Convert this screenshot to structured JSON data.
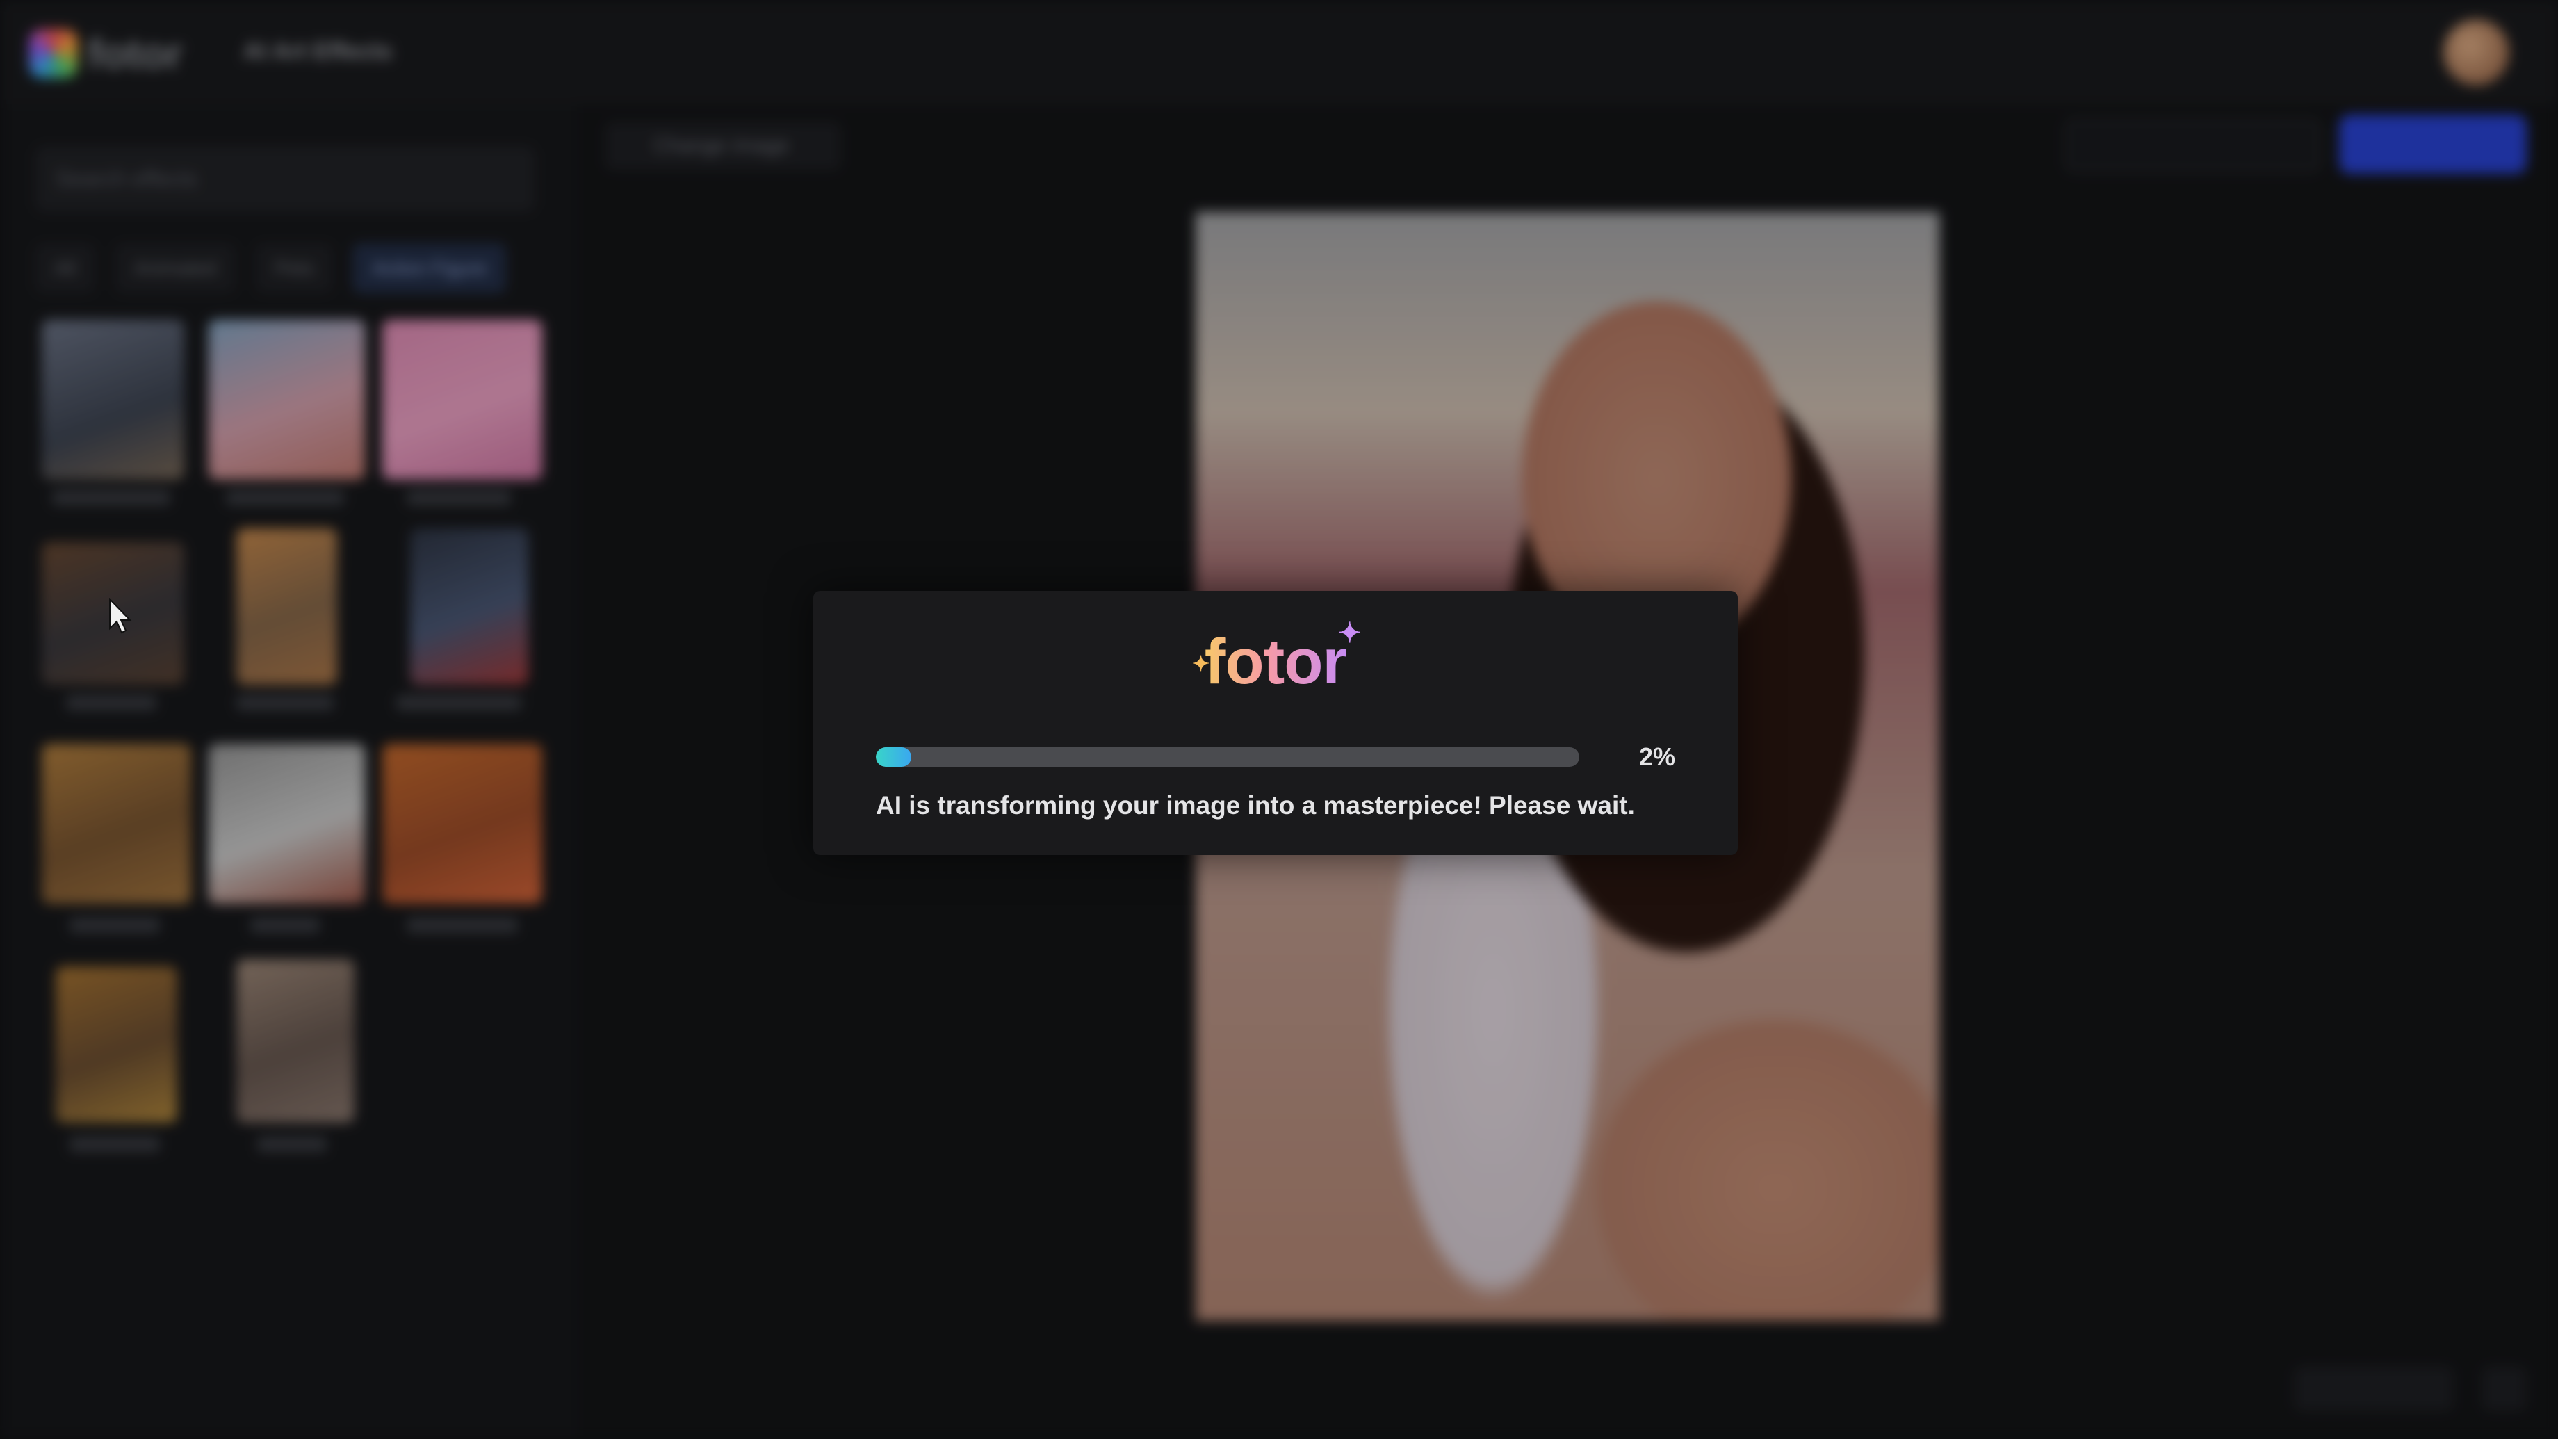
{
  "app": {
    "brand": "fotor",
    "title": "AI Art Effects",
    "search_placeholder": "Search effects",
    "chips": [
      "All",
      "Animated",
      "Pets",
      "Action Figure"
    ],
    "toolbar_left": "Change image",
    "colors": {
      "accent_blue": "#2a44d8",
      "background": "#141517"
    }
  },
  "modal": {
    "logo_text": "fotor",
    "progress_percent": 2,
    "progress_label": "2%",
    "message": "AI is transforming your image into a masterpiece! Please wait.",
    "colors": {
      "progress_start": "#39d5c8",
      "progress_end": "#3aa7f0",
      "logo_start": "#f7c86a",
      "logo_end": "#c78cf3"
    }
  },
  "icons": {
    "cursor": "cursor-arrow-icon",
    "spark": "sparkle-icon"
  }
}
